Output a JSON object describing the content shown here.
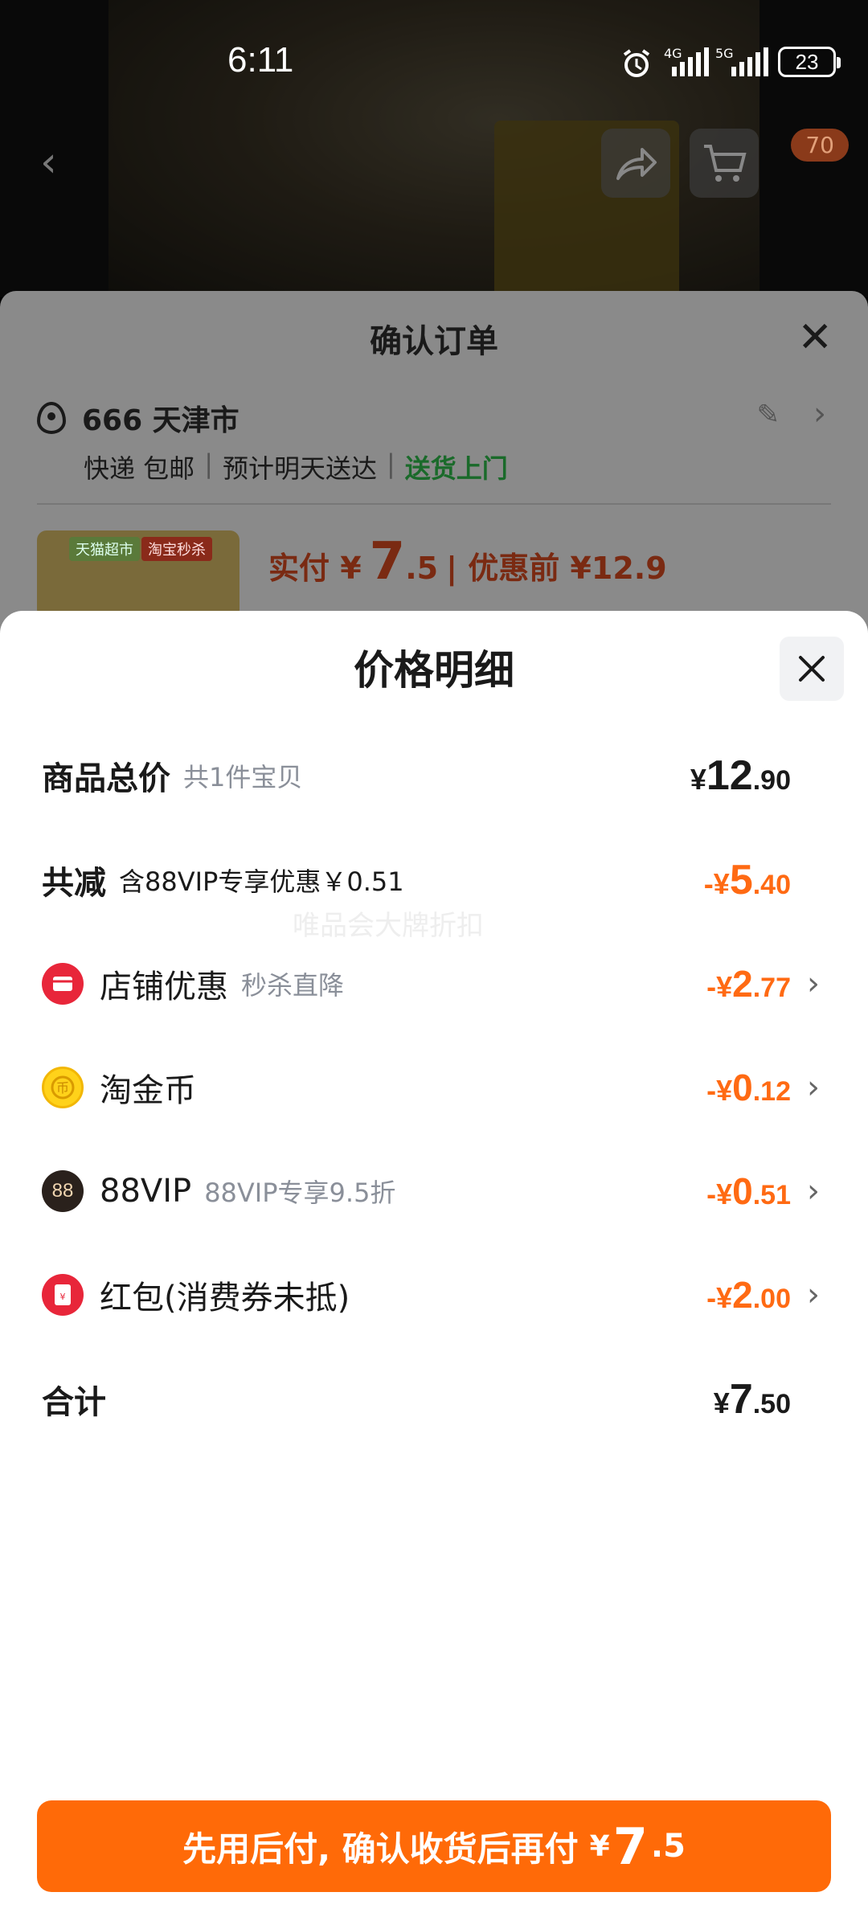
{
  "status_bar": {
    "time": "6:11",
    "network1": "4G",
    "network2": "5G",
    "battery": "23"
  },
  "nav": {
    "cart_badge": "70"
  },
  "order": {
    "title": "确认订单",
    "address": "666 天津市",
    "shipping": "快递 包邮",
    "eta": "预计明天送达",
    "delivery": "送货上门",
    "thumb_tag1": "天猫超市",
    "thumb_tag2": "淘宝秒杀",
    "pay_label": "实付 ¥",
    "pay_int": "7",
    "pay_dec": ".5",
    "before_label": "| 优惠前 ¥12.9"
  },
  "sheet": {
    "title": "价格明细",
    "watermark": "唯品会大牌折扣",
    "rows": {
      "total": {
        "name": "商品总价",
        "sub": "共1件宝贝",
        "cur": "¥",
        "int": "12",
        "dec": ".90"
      },
      "discount": {
        "name": "共减",
        "sub": "含88VIP专享优惠￥0.51",
        "cur": "-¥",
        "int": "5",
        "dec": ".40"
      },
      "shop": {
        "name": "店铺优惠",
        "sub": "秒杀直降",
        "cur": "-¥",
        "int": "2",
        "dec": ".77"
      },
      "coin": {
        "name": "淘金币",
        "sub": "",
        "cur": "-¥",
        "int": "0",
        "dec": ".12"
      },
      "vip": {
        "name": "88VIP",
        "sub": "88VIP专享9.5折",
        "cur": "-¥",
        "int": "0",
        "dec": ".51",
        "icon_text": "88"
      },
      "redpacket": {
        "name": "红包(消费券未抵)",
        "sub": "",
        "cur": "-¥",
        "int": "2",
        "dec": ".00"
      },
      "sum": {
        "name": "合计",
        "cur": "¥",
        "int": "7",
        "dec": ".50"
      }
    }
  },
  "cta": {
    "label": "先用后付, 确认收货后再付",
    "cur": "¥",
    "int": "7",
    "dec": ".5"
  },
  "colors": {
    "accent": "#ff6a08",
    "discount": "#ff6a13",
    "delivery_green": "#1a9a3a"
  }
}
